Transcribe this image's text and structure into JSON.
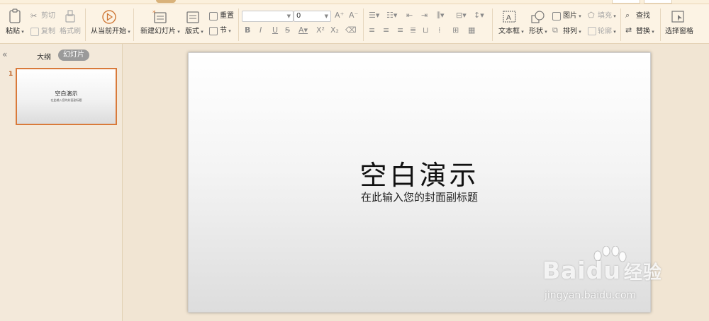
{
  "ribbon": {
    "paste": "粘贴",
    "cut": "剪切",
    "copy": "复制",
    "format_painter": "格式刷",
    "play_from_current": "从当前开始",
    "new_slide": "新建幻灯片",
    "layout": "版式",
    "reset": "重置",
    "section": "节",
    "font_name": "",
    "font_size": "0",
    "text_box": "文本框",
    "shape": "形状",
    "picture": "图片",
    "arrange": "排列",
    "fill": "填充",
    "outline": "轮廓",
    "find": "查找",
    "replace": "替换",
    "selection_pane": "选择窗格"
  },
  "left_panel": {
    "tab_outline": "大纲",
    "tab_slides": "幻灯片",
    "slides": [
      {
        "number": "1",
        "title": "空白演示",
        "subtitle": "在此输入您的封面副标题"
      }
    ]
  },
  "slide": {
    "title": "空白演示",
    "subtitle": "在此输入您的封面副标题"
  },
  "watermark": {
    "brand": "Bai",
    "brand_suffix": "du",
    "brand_cn": "经验",
    "url": "jingyan.baidu.com"
  },
  "colors": {
    "ribbon_bg": "#fcf3e4",
    "panel_bg": "#f3e9da",
    "accent": "#d97a3a"
  }
}
